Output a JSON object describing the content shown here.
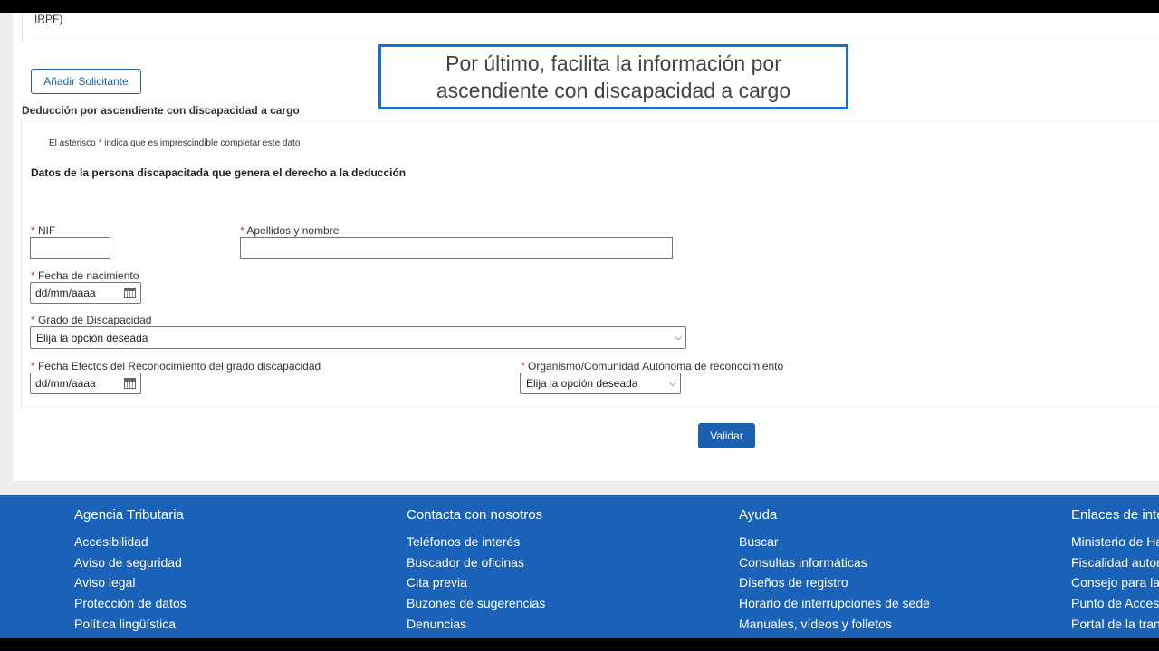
{
  "prev_section_tail": "IRPF)",
  "add_applicant_label": "Añadir Solicitante",
  "tooltip": {
    "line1": "Por último, facilita la información por",
    "line2": "ascendiente con discapacidad a cargo"
  },
  "section_title": "Deducción por ascendiente con discapacidad a cargo",
  "note": {
    "prefix": "El asterisco ",
    "asterisk": "*",
    "suffix": " indica que es imprescindible completar este dato"
  },
  "subtitle": "Datos de la persona discapacitada que genera el derecho a la deducción",
  "form": {
    "nif_label": "NIF",
    "nif_value": "",
    "name_label": "Apellidos y nombre",
    "name_value": "",
    "birth_label": "Fecha de nacimiento",
    "birth_placeholder": "dd/mm/aaaa",
    "grade_label": "Grado de Discapacidad",
    "grade_selected": "Elija la opción deseada",
    "effects_label": "Fecha Efectos del Reconocimiento del grado discapacidad",
    "effects_placeholder": "dd/mm/aaaa",
    "org_label": "Organismo/Comunidad Autónoma de reconocimiento",
    "org_selected": "Elija la opción deseada",
    "required_mark": "*"
  },
  "validate_label": "Validar",
  "footer": {
    "columns": [
      {
        "title": "Agencia Tributaria",
        "links": [
          "Accesibilidad",
          "Aviso de seguridad",
          "Aviso legal",
          "Protección de datos",
          "Política lingüística"
        ]
      },
      {
        "title": "Contacta con nosotros",
        "links": [
          "Teléfonos de interés",
          "Buscador de oficinas",
          "Cita previa",
          "Buzones de sugerencias",
          "Denuncias"
        ]
      },
      {
        "title": "Ayuda",
        "links": [
          "Buscar",
          "Consultas informáticas",
          "Diseños de registro",
          "Horario de interrupciones de sede",
          "Manuales, vídeos y folletos"
        ]
      },
      {
        "title": "Enlaces de inte",
        "links": [
          "Ministerio de Ha",
          "Fiscalidad auton",
          "Consejo para la",
          "Punto de Acceso",
          "Portal de la tran"
        ]
      }
    ]
  }
}
